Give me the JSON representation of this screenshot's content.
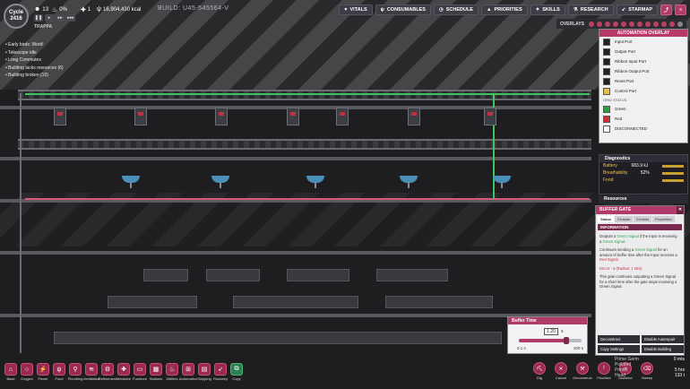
{
  "colony": {
    "cycle_label": "Cycle",
    "cycle_number": "2416",
    "name": "TRAPPA",
    "dupes": "13",
    "stress": "0%",
    "sick": "1",
    "calories": "16,904,430 kcal",
    "build_id": "BUILD: U45-545564-V"
  },
  "nav": [
    "VITALS",
    "CONSUMABLES",
    "SCHEDULE",
    "PRIORITIES",
    "SKILLS",
    "RESEARCH",
    "STARMAP"
  ],
  "overlays_label": "OVERLAYS",
  "checklist": [
    "Early birds: Work!",
    "Telescope idle",
    "Long Commutes",
    "Building lacks resources (6)",
    "Building broken (10)"
  ],
  "automation_overlay": {
    "title": "AUTOMATION OVERLAY",
    "ports": [
      "Input Port",
      "Output Port",
      "Ribbon Input Port",
      "Ribbon Output Port",
      "Reset Port",
      "Control Port"
    ],
    "grid_status_label": "GRID STATUS",
    "status": [
      "Green",
      "Red",
      "DISCONNECTED"
    ]
  },
  "diagnostics": {
    "title": "Diagnostics",
    "rows": [
      {
        "label": "Battery",
        "value": "683.9 kJ"
      },
      {
        "label": "Breathability",
        "value": "52%"
      },
      {
        "label": "Food",
        "value": ""
      }
    ]
  },
  "resources_label": "Resources",
  "gate_panel": {
    "title": "BUFFER GATE",
    "tabs": [
      "Status",
      "Errands",
      "Errands",
      "Properties"
    ],
    "info_label": "INFORMATION",
    "p1_a": "Outputs a ",
    "p1_b": "Green Signal",
    "p1_c": " if the Input is receiving a ",
    "p1_d": "Green Signal",
    "p1_e": ".",
    "p2_a": "Continues sending a ",
    "p2_b": "Green Signal",
    "p2_c": " for an amount of buffer time after the Input receives a ",
    "p2_d": "Red Signal",
    "p2_e": ".",
    "decor": "Decor: -4 (Radius: 1 tiles)",
    "p3": "This gate continues outputting a Green Signal for a short time after the gate stops receiving a Green Signal.",
    "buttons": [
      "Deconstruct",
      "Disable Autorepair",
      "Copy Settings",
      "Disable Building"
    ]
  },
  "buffer_time": {
    "title": "Buffer Time",
    "value": "1.20",
    "unit": "s",
    "min_label": "0.1 s",
    "max_label": "200 s",
    "fraction": 0.75
  },
  "toolbar": [
    "Base",
    "Oxygen",
    "Power",
    "Food",
    "Plumbing",
    "Ventilation",
    "Refinement",
    "Medicine",
    "Furniture",
    "Stations",
    "Utilities",
    "Automation",
    "Shipping",
    "Rocketry",
    "Copy"
  ],
  "rtools": [
    "Dig",
    "Cancel",
    "Deconstruct",
    "Prioritize",
    "Disinfect",
    "Sweep"
  ],
  "resource_list": [
    {
      "name": "Prime Germ",
      "value": "0 mts"
    },
    {
      "name": "Polluted",
      "value": ""
    },
    {
      "name": "Printer",
      "value": "5 hrs"
    },
    {
      "name": "Head",
      "value": "133 t"
    }
  ],
  "colors": {
    "accent": "#b03a6a",
    "green": "#2ea043",
    "red": "#d03030"
  }
}
